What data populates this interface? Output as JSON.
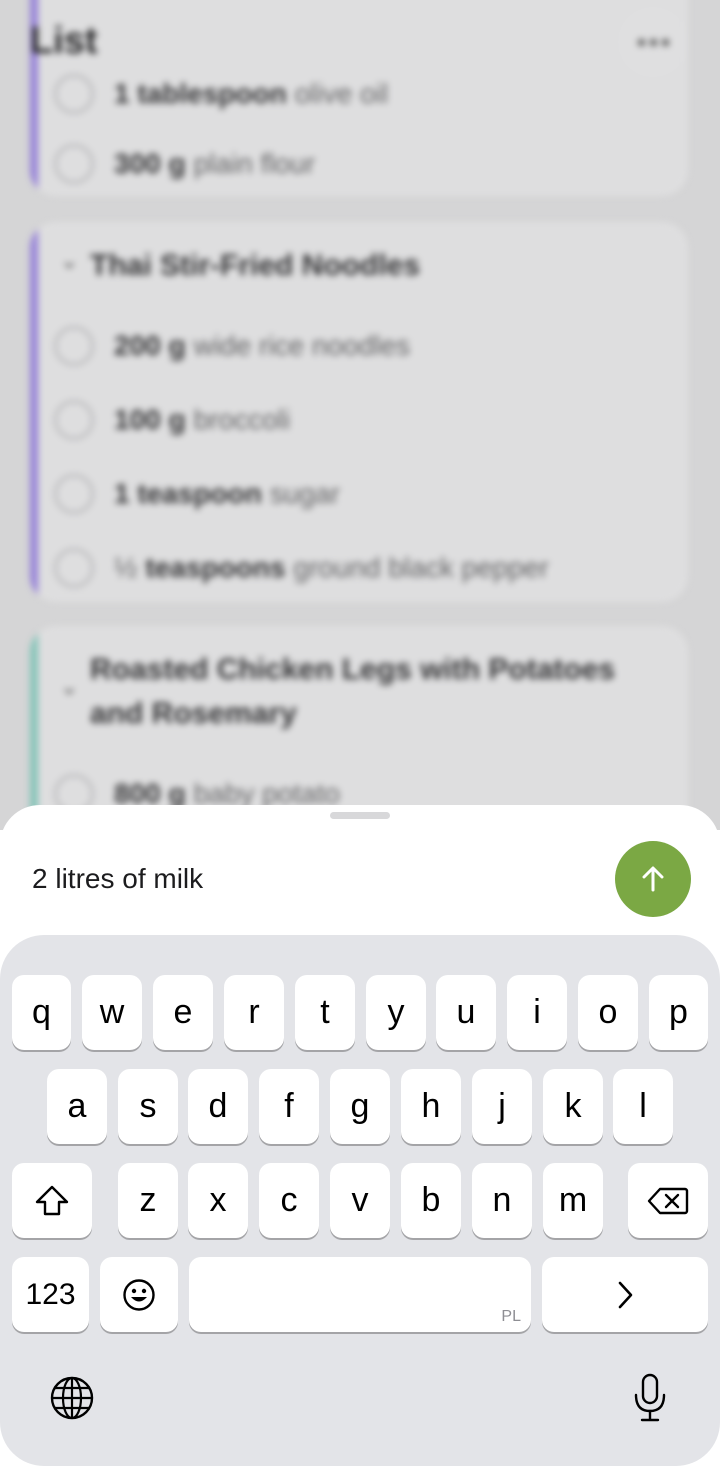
{
  "header": {
    "title": "List"
  },
  "list": {
    "partial_rows": [
      {
        "quantity": "1 tablespoon",
        "name": "olive oil"
      },
      {
        "quantity": "300 g",
        "name": "plain flour"
      }
    ],
    "sections": [
      {
        "title": "Thai Stir-Fried Noodles",
        "accent": "#a08be6",
        "items": [
          {
            "quantity": "200 g",
            "name": "wide rice noodles"
          },
          {
            "quantity": "100 g",
            "name": "broccoli"
          },
          {
            "quantity": "1 teaspoon",
            "name": "sugar"
          },
          {
            "prefix": "½",
            "quantity": "teaspoons",
            "name": "ground black pepper"
          }
        ]
      },
      {
        "title_line1": "Roasted Chicken Legs with Potatoes",
        "title_line2": "and Rosemary",
        "accent": "#8dd0c4",
        "items": [
          {
            "quantity": "800 g",
            "name": "baby potato"
          }
        ]
      }
    ]
  },
  "composer": {
    "input_value": "2 litres of milk",
    "send_color": "#7ba844",
    "send_icon": "arrow-up-icon"
  },
  "keyboard": {
    "row1": [
      "q",
      "w",
      "e",
      "r",
      "t",
      "y",
      "u",
      "i",
      "o",
      "p"
    ],
    "row2": [
      "a",
      "s",
      "d",
      "f",
      "g",
      "h",
      "j",
      "k",
      "l"
    ],
    "row3": [
      "z",
      "x",
      "c",
      "v",
      "b",
      "n",
      "m"
    ],
    "numbers_key": "123",
    "space_language": "PL",
    "icons": [
      "shift-icon",
      "backspace-icon",
      "emoji-icon",
      "chevron-right-icon",
      "globe-icon",
      "microphone-icon"
    ]
  }
}
